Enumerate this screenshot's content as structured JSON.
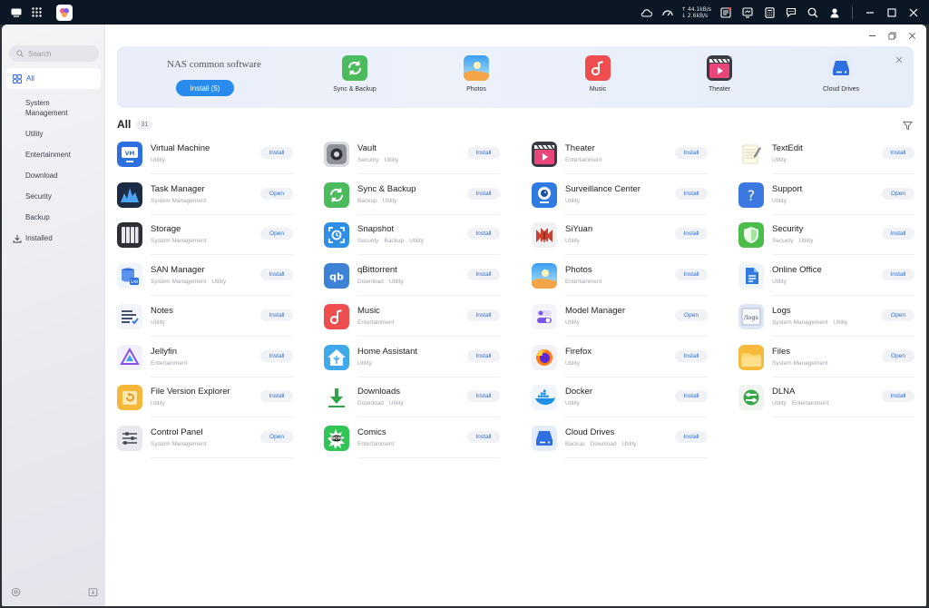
{
  "taskbar": {
    "net_up": "↑ 44.1kB/s",
    "net_down": "↓ 2.6kB/s"
  },
  "sidebar": {
    "search_placeholder": "Search",
    "items": [
      {
        "label": "All",
        "icon": "grid-icon",
        "active": true
      },
      {
        "label": "System Management"
      },
      {
        "label": "Utility"
      },
      {
        "label": "Entertainment"
      },
      {
        "label": "Download"
      },
      {
        "label": "Security"
      },
      {
        "label": "Backup"
      },
      {
        "label": "Installed",
        "icon": "download-icon"
      }
    ]
  },
  "banner": {
    "title": "NAS common software",
    "install_label": "Install (5)",
    "apps": [
      "Sync & Backup",
      "Photos",
      "Music",
      "Theater",
      "Cloud Drives"
    ]
  },
  "list": {
    "title": "All",
    "count": "31",
    "columns": [
      [
        {
          "name": "Virtual Machine",
          "tags": [
            "Utility"
          ],
          "action": "Install",
          "icon": "virtual-machine-icon"
        },
        {
          "name": "Task Manager",
          "tags": [
            "System Management"
          ],
          "action": "Open",
          "icon": "task-manager-icon"
        },
        {
          "name": "Storage",
          "tags": [
            "System Management"
          ],
          "action": "Open",
          "icon": "storage-icon"
        },
        {
          "name": "SAN Manager",
          "tags": [
            "System Management",
            "Utility"
          ],
          "action": "Install",
          "icon": "san-manager-icon"
        },
        {
          "name": "Notes",
          "tags": [
            "Utility"
          ],
          "action": "Install",
          "icon": "notes-icon"
        },
        {
          "name": "Jellyfin",
          "tags": [
            "Entertainment"
          ],
          "action": "Install",
          "icon": "jellyfin-icon"
        },
        {
          "name": "File Version Explorer",
          "tags": [
            "Utility"
          ],
          "action": "Install",
          "icon": "file-version-icon"
        },
        {
          "name": "Control Panel",
          "tags": [
            "System Management"
          ],
          "action": "Open",
          "icon": "control-panel-icon"
        }
      ],
      [
        {
          "name": "Vault",
          "tags": [
            "Security",
            "Utility"
          ],
          "action": "Install",
          "icon": "vault-icon"
        },
        {
          "name": "Sync & Backup",
          "tags": [
            "Backup",
            "Utility"
          ],
          "action": "Install",
          "icon": "sync-backup-icon"
        },
        {
          "name": "Snapshot",
          "tags": [
            "Security",
            "Backup",
            "Utility"
          ],
          "action": "Install",
          "icon": "snapshot-icon"
        },
        {
          "name": "qBittorrent",
          "tags": [
            "Download",
            "Utility"
          ],
          "action": "Install",
          "icon": "qbittorrent-icon"
        },
        {
          "name": "Music",
          "tags": [
            "Entertainment"
          ],
          "action": "Install",
          "icon": "music-icon"
        },
        {
          "name": "Home Assistant",
          "tags": [
            "Utility"
          ],
          "action": "Install",
          "icon": "home-assistant-icon"
        },
        {
          "name": "Downloads",
          "tags": [
            "Download",
            "Utility"
          ],
          "action": "Install",
          "icon": "downloads-icon"
        },
        {
          "name": "Comics",
          "tags": [
            "Entertainment"
          ],
          "action": "Install",
          "icon": "comics-icon"
        }
      ],
      [
        {
          "name": "Theater",
          "tags": [
            "Entertainment"
          ],
          "action": "Install",
          "icon": "theater-icon"
        },
        {
          "name": "Surveillance Center",
          "tags": [
            "Utility"
          ],
          "action": "Install",
          "icon": "surveillance-icon"
        },
        {
          "name": "SiYuan",
          "tags": [
            "Utility"
          ],
          "action": "Install",
          "icon": "siyuan-icon"
        },
        {
          "name": "Photos",
          "tags": [
            "Entertainment"
          ],
          "action": "Install",
          "icon": "photos-icon"
        },
        {
          "name": "Model Manager",
          "tags": [
            "Utility"
          ],
          "action": "Open",
          "icon": "model-manager-icon"
        },
        {
          "name": "Firefox",
          "tags": [
            "Utility"
          ],
          "action": "Install",
          "icon": "firefox-icon"
        },
        {
          "name": "Docker",
          "tags": [
            "Utility"
          ],
          "action": "Install",
          "icon": "docker-icon"
        },
        {
          "name": "Cloud Drives",
          "tags": [
            "Backup",
            "Download",
            "Utility"
          ],
          "action": "Install",
          "icon": "cloud-drives-icon"
        }
      ],
      [
        {
          "name": "TextEdit",
          "tags": [
            "Utility"
          ],
          "action": "Install",
          "icon": "textedit-icon"
        },
        {
          "name": "Support",
          "tags": [
            "Utility"
          ],
          "action": "Open",
          "icon": "support-icon"
        },
        {
          "name": "Security",
          "tags": [
            "Security",
            "Utility"
          ],
          "action": "Install",
          "icon": "security-icon"
        },
        {
          "name": "Online Office",
          "tags": [
            "Utility"
          ],
          "action": "Install",
          "icon": "online-office-icon"
        },
        {
          "name": "Logs",
          "tags": [
            "System Management",
            "Utility"
          ],
          "action": "Open",
          "icon": "logs-icon"
        },
        {
          "name": "Files",
          "tags": [
            "System Management"
          ],
          "action": "Open",
          "icon": "files-icon"
        },
        {
          "name": "DLNA",
          "tags": [
            "Utility",
            "Entertainment"
          ],
          "action": "Install",
          "icon": "dlna-icon"
        }
      ]
    ]
  },
  "colors": {
    "accent": "#2a8bee",
    "link": "#2a6fd8",
    "taskbar": "#0c1726"
  }
}
